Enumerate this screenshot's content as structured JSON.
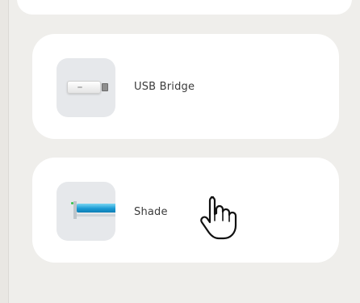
{
  "devices": [
    {
      "label": "USB Bridge",
      "icon": "usb-stick-icon"
    },
    {
      "label": "Shade",
      "icon": "shade-roller-icon"
    }
  ],
  "cursor": {
    "icon": "pointer-hand-icon"
  },
  "colors": {
    "background": "#efeeeb",
    "card": "#ffffff",
    "thumbnail": "#e6e8eb",
    "shade_blue": "#1a9bd4",
    "led_green": "#35c24a",
    "label_text": "#3b3b3b"
  }
}
